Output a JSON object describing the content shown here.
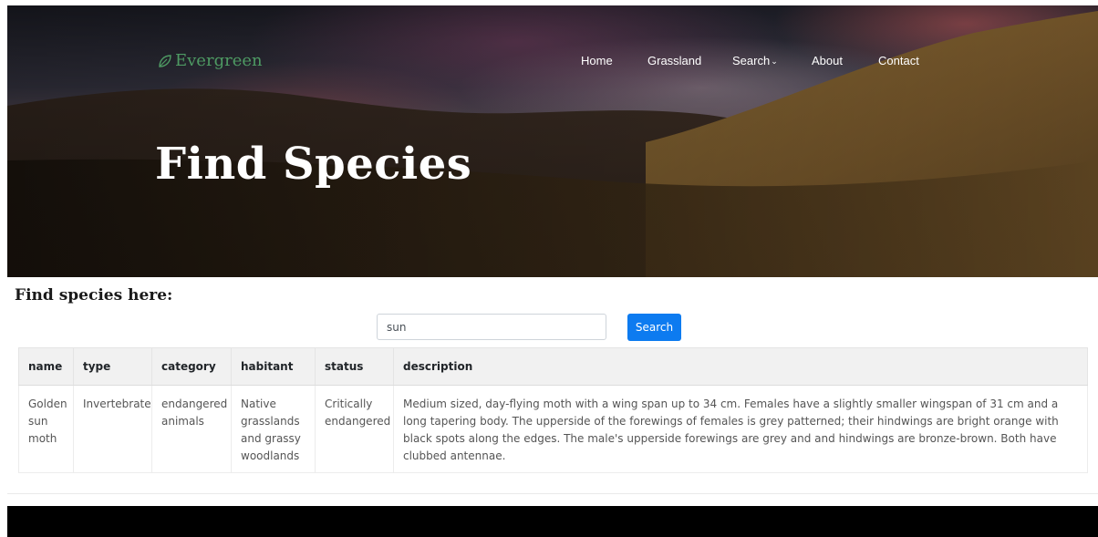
{
  "brand": {
    "name": "Evergreen"
  },
  "nav": {
    "items": [
      {
        "label": "Home"
      },
      {
        "label": "Grassland"
      },
      {
        "label": "Search"
      },
      {
        "label": "About"
      },
      {
        "label": "Contact"
      }
    ]
  },
  "hero": {
    "title": "Find Species"
  },
  "search": {
    "heading": "Find species here:",
    "value": "sun",
    "button_label": "Search"
  },
  "table": {
    "columns": [
      "name",
      "type",
      "category",
      "habitant",
      "status",
      "description"
    ],
    "rows": [
      {
        "name": "Golden sun moth",
        "type": "Invertebrate",
        "category": "endangered animals",
        "habitant": "Native grasslands and grassy woodlands",
        "status": "Critically endangered",
        "description": "Medium sized, day-flying moth with a wing span up to 34 cm. Females have a slightly smaller wingspan of 31 cm and a long tapering body. The upperside of the forewings of females is grey patterned; their hindwings are bright orange with black spots along the edges. The male's upperside forewings are grey and and hindwings are bronze-brown. Both have clubbed antennae."
      }
    ]
  },
  "colors": {
    "brand": "#4e9a63",
    "primary_button": "#0d7bf0",
    "table_header_bg": "#f1f1f1",
    "footer_bg": "#000000"
  },
  "icons": {
    "brand": "leaf-icon",
    "nav_dropdown": "chevron-down-icon"
  }
}
